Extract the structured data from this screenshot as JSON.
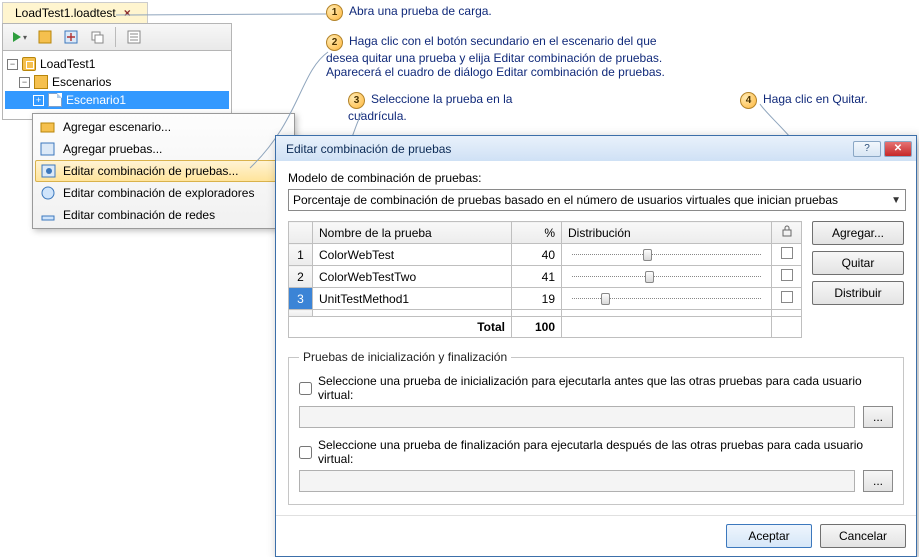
{
  "explorer": {
    "tab_title": "LoadTest1.loadtest",
    "tree": {
      "root": "LoadTest1",
      "scenarios_label": "Escenarios",
      "scenario1": "Escenario1"
    }
  },
  "context_menu": {
    "items": [
      "Agregar escenario...",
      "Agregar pruebas...",
      "Editar combinación de pruebas...",
      "Editar combinación de exploradores",
      "Editar combinación de redes"
    ],
    "selected_index": 2
  },
  "callouts": {
    "c1": "Abra una prueba de carga.",
    "c2": "Haga clic con el botón secundario en el escenario del que desea quitar una prueba y elija Editar combinación de pruebas. Aparecerá el cuadro de diálogo Editar combinación de pruebas.",
    "c3": "Seleccione la prueba en la cuadrícula.",
    "c4": "Haga clic en Quitar."
  },
  "dialog": {
    "title": "Editar combinación de pruebas",
    "model_label": "Modelo de combinación de pruebas:",
    "model_value": "Porcentaje de combinación de pruebas basado en el número de usuarios virtuales que inician pruebas",
    "headers": {
      "name": "Nombre de la prueba",
      "pct": "%",
      "dist": "Distribución",
      "lock": ""
    },
    "rows": [
      {
        "name": "ColorWebTest",
        "pct": 40
      },
      {
        "name": "ColorWebTestTwo",
        "pct": 41
      },
      {
        "name": "UnitTestMethod1",
        "pct": 19
      }
    ],
    "total_label": "Total",
    "total_value": 100,
    "selected_row": 2,
    "side_buttons": {
      "add": "Agregar...",
      "remove": "Quitar",
      "distribute": "Distribuir"
    },
    "group": {
      "legend": "Pruebas de inicialización y finalización",
      "init_check": "Seleccione una prueba de inicialización para ejecutarla antes que las otras pruebas para cada usuario virtual:",
      "fin_check": "Seleccione una prueba de finalización para ejecutarla después de las otras pruebas para cada usuario virtual:",
      "ellipsis": "..."
    },
    "footer": {
      "ok": "Aceptar",
      "cancel": "Cancelar"
    }
  }
}
